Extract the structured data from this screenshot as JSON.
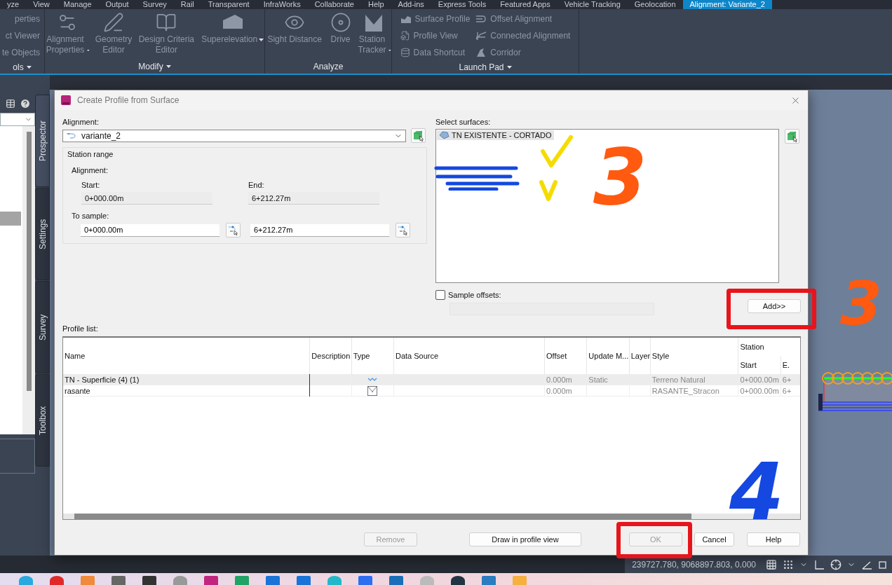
{
  "ribbon_tabs": [
    {
      "label": "yze",
      "selected": false
    },
    {
      "label": "View",
      "selected": false
    },
    {
      "label": "Manage",
      "selected": false
    },
    {
      "label": "Output",
      "selected": false
    },
    {
      "label": "Survey",
      "selected": false
    },
    {
      "label": "Rail",
      "selected": false
    },
    {
      "label": "Transparent",
      "selected": false
    },
    {
      "label": "InfraWorks",
      "selected": false
    },
    {
      "label": "Collaborate",
      "selected": false
    },
    {
      "label": "Help",
      "selected": false
    },
    {
      "label": "Add-ins",
      "selected": false
    },
    {
      "label": "Express Tools",
      "selected": false
    },
    {
      "label": "Featured Apps",
      "selected": false
    },
    {
      "label": "Vehicle Tracking",
      "selected": false
    },
    {
      "label": "Geolocation",
      "selected": false
    },
    {
      "label": "Alignment: Variante_2",
      "selected": true
    }
  ],
  "ribbon_groups": [
    {
      "label": "ols",
      "menu": true,
      "tools": [
        {
          "kind": "text",
          "label": "perties"
        },
        {
          "kind": "text",
          "label": "ct Viewer"
        },
        {
          "kind": "text",
          "label": "te Objects"
        }
      ]
    },
    {
      "label": "Modify",
      "menu": true,
      "tools": [
        {
          "kind": "large",
          "label": "Alignment Properties",
          "dropdown": true
        },
        {
          "kind": "large",
          "label": "Geometry Editor",
          "dropdown": false
        },
        {
          "kind": "large",
          "label": "Design Criteria Editor",
          "dropdown": false
        },
        {
          "kind": "large",
          "label": "Superelevation",
          "dropdown": true
        }
      ]
    },
    {
      "label": "Analyze",
      "menu": false,
      "tools": [
        {
          "kind": "large",
          "label": "Sight Distance",
          "dropdown": false
        },
        {
          "kind": "large",
          "label": "Drive",
          "dropdown": false
        },
        {
          "kind": "large",
          "label": "Station Tracker",
          "dropdown": true
        }
      ]
    },
    {
      "label": "Launch Pad",
      "menu": true,
      "tools": [
        {
          "kind": "small",
          "label": "Surface Profile"
        },
        {
          "kind": "small",
          "label": "Profile View"
        },
        {
          "kind": "small",
          "label": "Data Shortcut"
        },
        {
          "kind": "small",
          "label": "Offset Alignment"
        },
        {
          "kind": "small",
          "label": "Connected Alignment"
        },
        {
          "kind": "small",
          "label": "Corridor"
        }
      ]
    }
  ],
  "palette_tabs": [
    {
      "label": "Prospector",
      "selected": true
    },
    {
      "label": "Settings",
      "selected": false
    },
    {
      "label": "Survey",
      "selected": false
    },
    {
      "label": "Toolbox",
      "selected": false
    }
  ],
  "dialog": {
    "title": "Create Profile from Surface",
    "alignment": {
      "label": "Alignment:",
      "value": "variante_2"
    },
    "station_range": {
      "title": "Station range",
      "subtitle": "Alignment:",
      "start_label": "Start:",
      "start": "0+000.00m",
      "end_label": "End:",
      "end": "6+212.27m",
      "sample_label": "To sample:",
      "sample_start": "0+000.00m",
      "sample_end": "6+212.27m"
    },
    "surfaces": {
      "label": "Select surfaces:",
      "items": [
        {
          "name": "TN EXISTENTE - CORTADO",
          "selected": true
        }
      ]
    },
    "sample_offsets": {
      "label": "Sample offsets:",
      "checked": false
    },
    "add_button": "Add>>",
    "profile_list": {
      "label": "Profile list:",
      "columns": [
        "Name",
        "Description",
        "Type",
        "Data Source",
        "Offset",
        "Update M...",
        "Layer",
        "Style"
      ],
      "group": {
        "label": "Station",
        "columns": [
          "Start",
          "E."
        ]
      },
      "rows": [
        {
          "name": "TN - Superficie (4) (1)",
          "kind": "surface",
          "offset": "0.000m",
          "update_mode": "Static",
          "style": "Terreno Natural",
          "start": "0+000.00m",
          "end": "6+",
          "selected": true
        },
        {
          "name": "rasante",
          "kind": "layout",
          "offset": "0.000m",
          "update_mode": "",
          "style": "RASANTE_Stracon",
          "start": "0+000.00m",
          "end": "6+",
          "selected": false
        }
      ]
    },
    "buttons": [
      {
        "label": "Remove",
        "disabled": true
      },
      {
        "label": "Draw in profile view",
        "disabled": false
      },
      {
        "label": "OK",
        "disabled": true
      },
      {
        "label": "Cancel",
        "disabled": false
      },
      {
        "label": "Help",
        "disabled": false
      }
    ]
  },
  "status_bar": {
    "coordinates": "239727.780, 9068897.803, 0.000"
  },
  "annotations": [
    {
      "kind": "scribble",
      "color": "#1448e0"
    },
    {
      "kind": "check",
      "color": "#f5dc00"
    },
    {
      "kind": "digit",
      "text": "3",
      "color": "#ff5a10"
    },
    {
      "kind": "frame",
      "color": "#e8141c"
    },
    {
      "kind": "digit",
      "text": "3",
      "color": "#ff5a10"
    },
    {
      "kind": "frame",
      "color": "#e8141c"
    },
    {
      "kind": "digit",
      "text": "4",
      "color": "#1448e0"
    }
  ]
}
